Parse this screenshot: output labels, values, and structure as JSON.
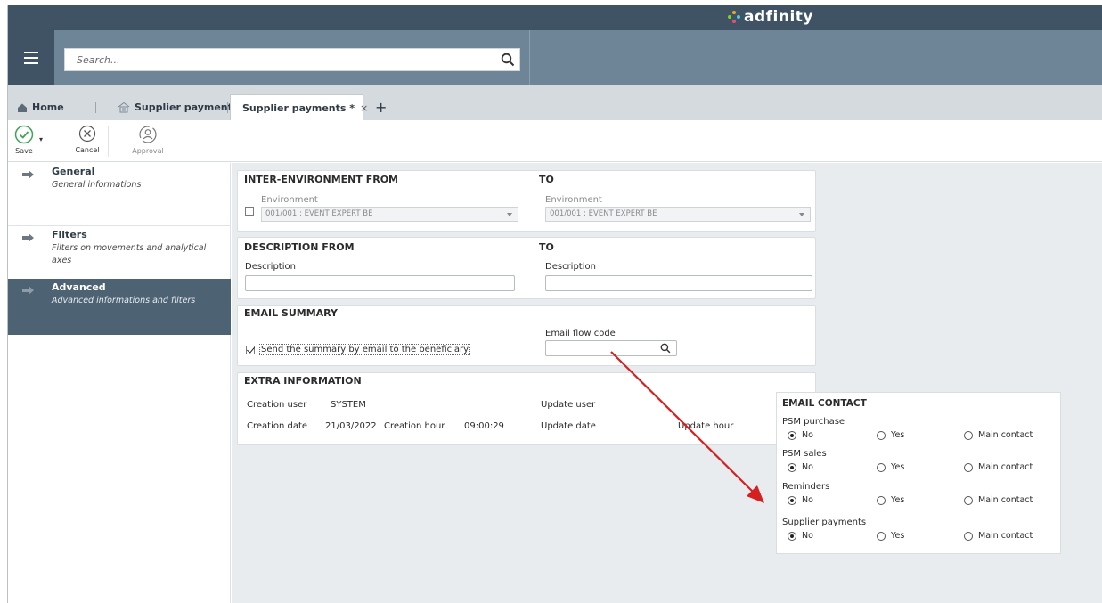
{
  "app": {
    "brand": "adfinity",
    "search_placeholder": "Search..."
  },
  "tabs": {
    "home": "Home",
    "supplier_payments_1": "Supplier payments",
    "supplier_payments_2": "Supplier payments *",
    "close": "×",
    "add": "+"
  },
  "toolbar": {
    "save": "Save",
    "cancel": "Cancel",
    "approval": "Approval"
  },
  "sidebar": {
    "items": [
      {
        "title": "General",
        "subtitle": "General informations"
      },
      {
        "title": "Filters",
        "subtitle": "Filters on movements and analytical axes"
      },
      {
        "title": "Advanced",
        "subtitle": "Advanced informations and filters"
      }
    ]
  },
  "inter_env": {
    "title_from": "INTER-ENVIRONMENT FROM",
    "title_to": "TO",
    "env_label": "Environment",
    "env_from_value": "001/001  :  EVENT EXPERT BE",
    "env_to_value": "001/001  :  EVENT EXPERT BE"
  },
  "description": {
    "title_from": "DESCRIPTION FROM",
    "title_to": "TO",
    "label": "Description"
  },
  "email_summary": {
    "title": "EMAIL SUMMARY",
    "checkbox_label": "Send the summary by email to the beneficiary",
    "flow_code_label": "Email flow code"
  },
  "extra": {
    "title": "EXTRA INFORMATION",
    "creation_user_label": "Creation user",
    "creation_user_value": "SYSTEM",
    "creation_date_label": "Creation date",
    "creation_date_value": "21/03/2022",
    "creation_hour_label": "Creation hour",
    "creation_hour_value": "09:00:29",
    "update_user_label": "Update user",
    "update_date_label": "Update date",
    "update_hour_label": "Update hour"
  },
  "email_contact": {
    "title": "EMAIL CONTACT",
    "options": [
      "No",
      "Yes",
      "Main contact"
    ],
    "groups": [
      {
        "label": "PSM purchase",
        "selected": "No"
      },
      {
        "label": "PSM sales",
        "selected": "No"
      },
      {
        "label": "Reminders",
        "selected": "No"
      },
      {
        "label": "Supplier payments",
        "selected": "No"
      }
    ]
  },
  "colors": {
    "topbar": "#3f5364",
    "searchbar": "#6d8596",
    "sidebar_active": "#4d6273",
    "save_green": "#3aa655",
    "annotation_arrow": "#d42020"
  }
}
